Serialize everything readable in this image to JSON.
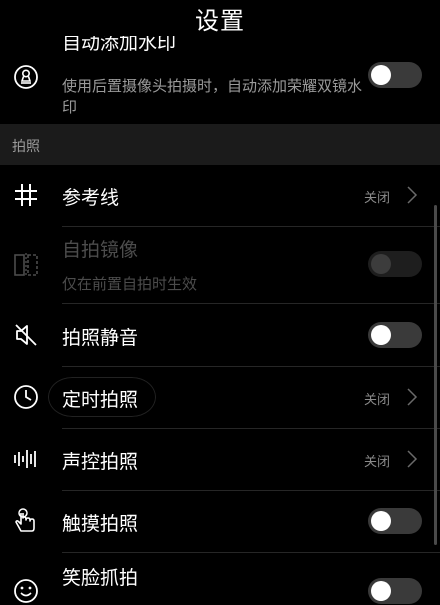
{
  "header": {
    "title": "设置"
  },
  "watermark": {
    "label": "自动添加水印",
    "desc": "使用后置摄像头拍摄时，自动添加荣耀双镜水印",
    "icon": "watermark-icon",
    "toggle": false
  },
  "section": {
    "label": "拍照"
  },
  "items": [
    {
      "label": "参考线",
      "value": "关闭",
      "icon": "grid-icon"
    },
    {
      "label": "自拍镜像",
      "desc": "仅在前置自拍时生效",
      "icon": "mirror-icon",
      "toggle": false,
      "disabled": true
    },
    {
      "label": "拍照静音",
      "icon": "mute-icon",
      "toggle": false
    },
    {
      "label": "定时拍照",
      "value": "关闭",
      "icon": "timer-icon"
    },
    {
      "label": "声控拍照",
      "value": "关闭",
      "icon": "voice-wave-icon"
    },
    {
      "label": "触摸拍照",
      "icon": "touch-icon",
      "toggle": false
    },
    {
      "label": "笑脸抓拍",
      "icon": "smile-icon",
      "toggle": false
    }
  ],
  "colors": {
    "background": "#000000",
    "section": "#1b1b1b",
    "secondary_text": "#9a9a9a"
  }
}
